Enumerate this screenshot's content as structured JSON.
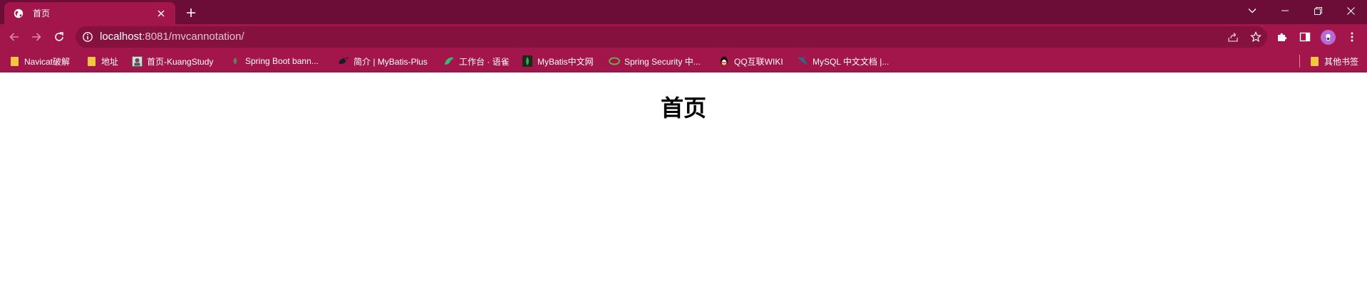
{
  "tab": {
    "title": "首页"
  },
  "address_bar": {
    "host": "localhost",
    "path": ":8081/mvcannotation/"
  },
  "bookmarks": [
    {
      "label": "Navicat破解",
      "icon": "folder-icon"
    },
    {
      "label": "地址",
      "icon": "folder-icon"
    },
    {
      "label": "首页-KuangStudy",
      "icon": "kuangstudy-favicon"
    },
    {
      "label": "Spring Boot bann...",
      "icon": "leaf-favicon"
    },
    {
      "label": "简介 | MyBatis-Plus",
      "icon": "mybatis-plus-favicon"
    },
    {
      "label": "工作台 · 语雀",
      "icon": "yuque-favicon"
    },
    {
      "label": "MyBatis中文网",
      "icon": "mybatis-favicon"
    },
    {
      "label": "Spring Security 中...",
      "icon": "spring-favicon"
    },
    {
      "label": "QQ互联WIKI",
      "icon": "qq-favicon"
    },
    {
      "label": "MySQL 中文文档 |...",
      "icon": "mysql-favicon"
    }
  ],
  "other_bookmarks": {
    "label": "其他书签"
  },
  "page": {
    "heading": "首页"
  },
  "colors": {
    "frame": "#6b0d36",
    "toolbar": "#a3164c",
    "omnibox": "#85113f",
    "accent_avatar": "#b86ad6"
  }
}
